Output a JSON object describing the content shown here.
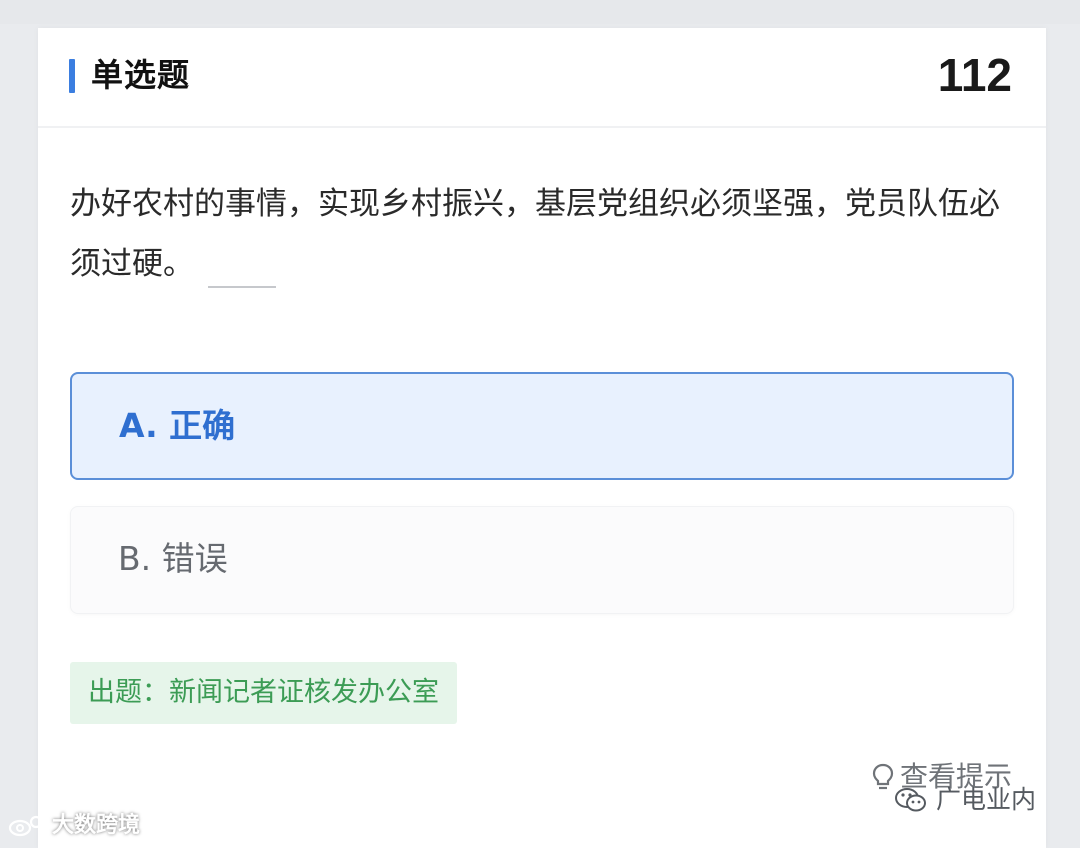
{
  "header": {
    "question_type": "单选题",
    "question_number": "112"
  },
  "question": {
    "text": "办好农村的事情，实现乡村振兴，基层党组织必须坚强，党员队伍必须过硬。"
  },
  "options": [
    {
      "label": "A. 正确",
      "selected": true
    },
    {
      "label": "B. 错误",
      "selected": false
    }
  ],
  "source": {
    "text": "出题：新闻记者证核发办公室"
  },
  "hint": {
    "label": "查看提示",
    "icon": "lightbulb-icon"
  },
  "watermarks": {
    "right_text": "广电业内",
    "right_icon": "wechat-icon",
    "left_text": "大数跨境",
    "left_icon": "weibo-icon"
  },
  "colors": {
    "accent_blue": "#3b7ee0",
    "selected_bg": "#e8f1fe",
    "selected_border": "#5b8fd8",
    "source_bg": "#e6f5ea",
    "source_text": "#3c9c55"
  }
}
